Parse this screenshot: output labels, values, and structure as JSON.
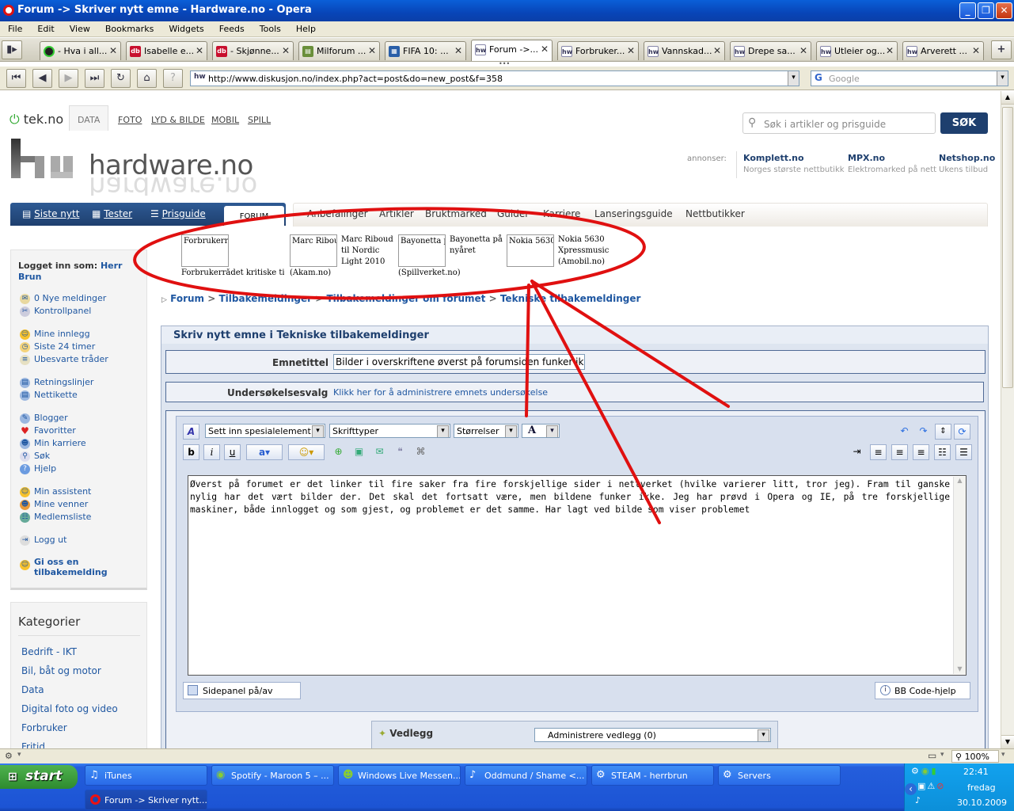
{
  "window": {
    "title": "Forum -> Skriver nytt emne - Hardware.no - Opera"
  },
  "menu": [
    "File",
    "Edit",
    "View",
    "Bookmarks",
    "Widgets",
    "Feeds",
    "Tools",
    "Help"
  ],
  "tabs": [
    "- Hva i all...",
    "Isabelle e...",
    "- Skjønne...",
    "Milforum ...",
    "FIFA 10: ...",
    "Forum ->...",
    "Forbruker...",
    "Vannskad...",
    "Drepe sa...",
    "Utleier og...",
    "Arverett ..."
  ],
  "address": {
    "url": "http://www.diskusjon.no/index.php?act=post&do=new_post&f=358",
    "search_placeholder": "Google"
  },
  "site": {
    "tek_logo": "tek.no",
    "sites": [
      "DATA",
      "FOTO",
      "LYD & BILDE",
      "MOBIL",
      "SPILL"
    ],
    "search_placeholder": "Søk i artikler og prisguide",
    "search_button": "SØK",
    "brand": "hardware.no",
    "ads_label": "annonser:",
    "ads": [
      {
        "name": "Komplett.no",
        "desc": "Norges største nettbutikk"
      },
      {
        "name": "MPX.no",
        "desc": "Elektromarked på nett"
      },
      {
        "name": "Netshop.no",
        "desc": "Ukens tilbud"
      }
    ],
    "main_nav": [
      "Siste nytt",
      "Tester",
      "Prisguide",
      "FORUM"
    ],
    "sub_nav": [
      "Anbefalinger",
      "Artikler",
      "Bruktmarked",
      "Guider",
      "Karriere",
      "Lanseringsguide",
      "Nettbutikker"
    ],
    "teasers": [
      {
        "img_alt": "Forbrukerrå",
        "caption": "",
        "source": "Forbrukerrådet kritiske til"
      },
      {
        "img_alt": "Marc Riboud",
        "caption": "Marc Riboud til Nordic Light 2010",
        "source": "(Akam.no)"
      },
      {
        "img_alt": "Bayonetta p",
        "caption": "Bayonetta på nyåret",
        "source": "(Spillverket.no)"
      },
      {
        "img_alt": "Nokia 5630",
        "caption": "Nokia 5630 Xpressmusic (Amobil.no)",
        "source": ""
      }
    ]
  },
  "sidebar": {
    "logged_label": "Logget inn som:",
    "user": "Herr Brun",
    "group1": [
      "0 Nye meldinger",
      "Kontrollpanel"
    ],
    "group2": [
      "Mine innlegg",
      "Siste 24 timer",
      "Ubesvarte tråder"
    ],
    "group3": [
      "Retningslinjer",
      "Nettikette"
    ],
    "group4": [
      "Blogger",
      "Favoritter",
      "Min karriere",
      "Søk",
      "Hjelp"
    ],
    "group5": [
      "Min assistent",
      "Mine venner",
      "Medlemsliste"
    ],
    "group6": [
      "Logg ut"
    ],
    "feedback": "Gi oss en tilbakemelding",
    "categories_title": "Kategorier",
    "categories": [
      "Bedrift - IKT",
      "Bil, båt og motor",
      "Data",
      "Digital foto og video",
      "Forbruker",
      "Fritid"
    ]
  },
  "breadcrumb": [
    "Forum",
    "Tilbakemeldinger",
    "Tilbakemeldinger om forumet",
    "Tekniske tilbakemeldinger"
  ],
  "form": {
    "title": "Skriv nytt emne i Tekniske tilbakemeldinger",
    "topic_label": "Emnetittel",
    "topic_value": "Bilder i overskriftene øverst på forumsiden funker ikke",
    "poll_label": "Undersøkelsesvalg",
    "poll_link": "Klikk her for å administrere emnets undersøkelse",
    "special": "Sett inn spesialelement",
    "fonts": "Skrifttyper",
    "sizes": "Størrelser",
    "body": "Øverst på forumet er det linker til fire saker fra fire forskjellige sider i nettverket (hvilke varierer litt, tror jeg). Fram til ganske nylig har det vært bilder der. Det skal det fortsatt være, men bildene funker ikke. Jeg har prøvd i Opera og IE, på tre forskjellige maskiner, både innlogget og som gjest, og problemet er det samme. Har lagt ved bilde som viser problemet",
    "sidepanel": "Sidepanel på/av",
    "bbcode": "BB Code-hjelp",
    "attach_label": "Vedlegg",
    "attach_select": "Administrere vedlegg (0)"
  },
  "status": {
    "zoom": "100%"
  },
  "taskbar": {
    "start": "start",
    "row1": [
      "iTunes",
      "Spotify - Maroon 5 – ...",
      "Windows Live Messen...",
      "Oddmund / Shame <...",
      "STEAM - herrbrun",
      "Servers"
    ],
    "row2": [
      "Forum -> Skriver nytt..."
    ],
    "time": "22:41",
    "day": "fredag",
    "date": "30.10.2009"
  },
  "colors": {
    "accent": "#1f57a1",
    "annotation": "#e01010",
    "nav_dark": "#1e3f6e"
  }
}
